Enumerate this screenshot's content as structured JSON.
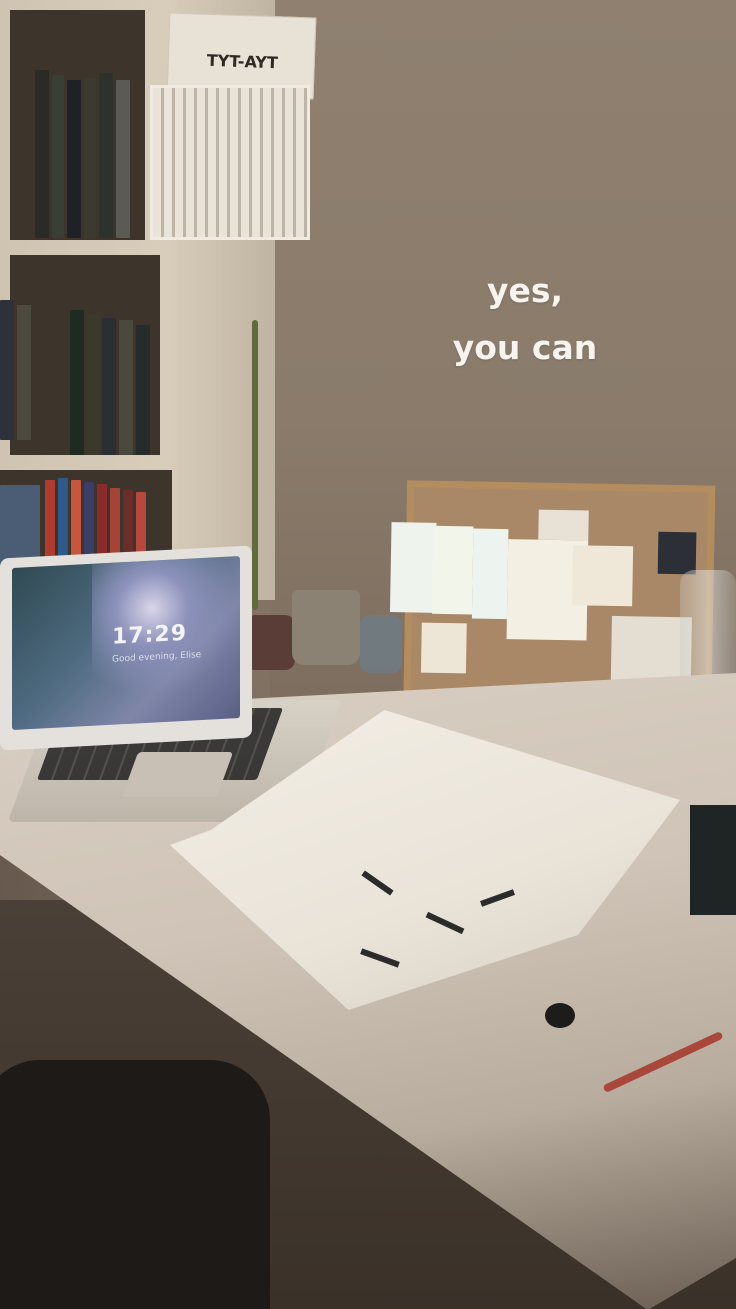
{
  "quote": {
    "line1": "yes,",
    "line2": "you can"
  },
  "laptop": {
    "time": "17:29",
    "greeting": "Good evening, Elise"
  },
  "magazine": {
    "label": "TYT-AYT"
  },
  "colors": {
    "quote_text": "#f7f3ee",
    "wall": "#8f8070",
    "desk": "#d9cfc2"
  }
}
